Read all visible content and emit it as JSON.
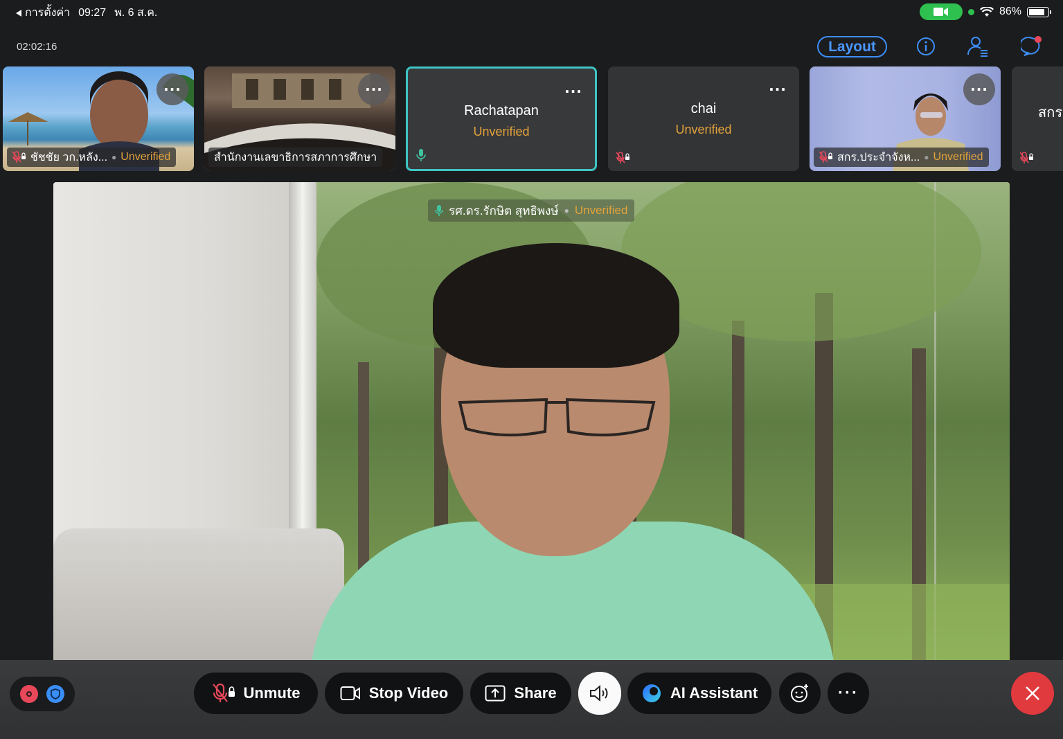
{
  "status_bar": {
    "back_label": "การตั้งค่า",
    "time": "09:27",
    "date": "พ. 6 ส.ค.",
    "battery": "86%",
    "battery_level": 0.86
  },
  "top_bar": {
    "timer": "02:02:16",
    "layout_label": "Layout"
  },
  "participants": [
    {
      "label": "ชัชชัย  วก.หลัง...",
      "status": "Unverified",
      "muted": true
    },
    {
      "label": "สำนักงานเลขาธิการสภาการศึกษา",
      "status": "",
      "muted": false
    },
    {
      "name": "Rachatapan",
      "status": "Unverified",
      "active": true
    },
    {
      "name": "chai",
      "status": "Unverified",
      "muted": true
    },
    {
      "label": "สกร.ประจำจังห...",
      "status": "Unverified",
      "muted": true
    },
    {
      "name": "สกร",
      "muted": true
    }
  ],
  "main_speaker": {
    "name": "รศ.ดร.รักษิต สุทธิพงษ์",
    "status": "Unverified"
  },
  "controls": {
    "unmute_label": "Unmute",
    "stop_video_label": "Stop Video",
    "share_label": "Share",
    "ai_assistant_label": "AI Assistant"
  },
  "colors": {
    "accent_blue": "#3e8ef7",
    "unverified": "#e3a33b",
    "active_border": "#3fc4c4",
    "end_call": "#e0393e",
    "mic_muted": "#e8485a"
  }
}
